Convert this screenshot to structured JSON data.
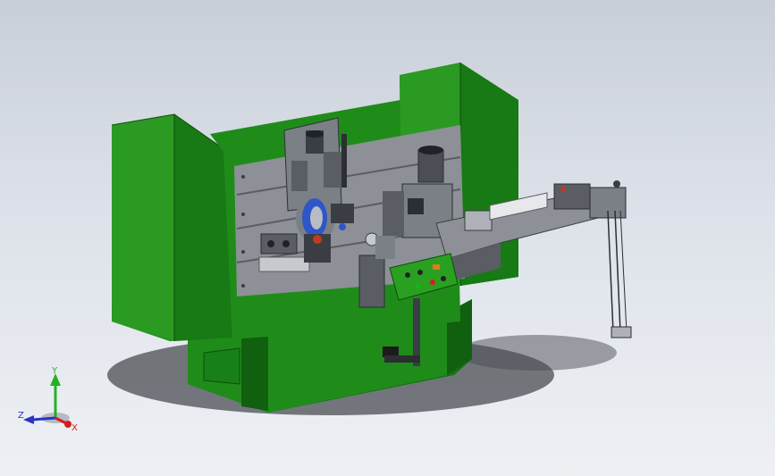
{
  "triad": {
    "x_label": "X",
    "y_label": "Y",
    "z_label": "Z",
    "x_color": "#d21e1e",
    "y_color": "#25b025",
    "z_color": "#2a34c8"
  },
  "colors": {
    "background_top": "#c9cfd8",
    "background_bottom": "#eef0f4",
    "frame_green": "#1f8c1a",
    "frame_green_dark": "#106010",
    "plate_gray": "#8d9096",
    "metal_dark": "#3a3d44",
    "wheel_blue": "#2f56c8"
  },
  "icons": {
    "triad": "coordinate-triad-icon"
  }
}
